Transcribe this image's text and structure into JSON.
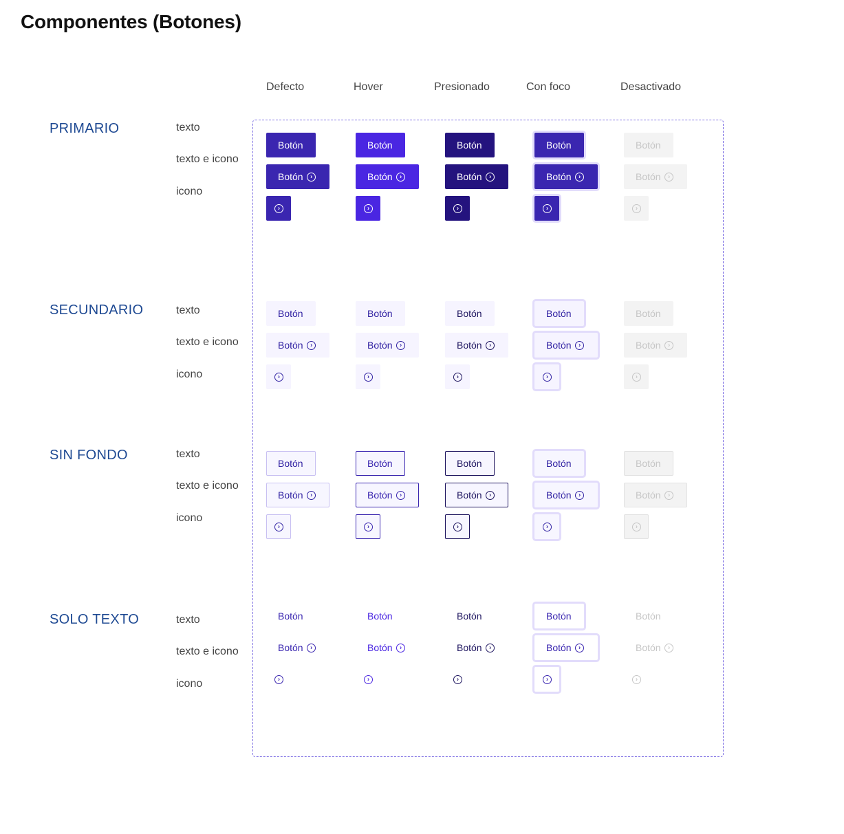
{
  "title": "Componentes (Botones)",
  "states": [
    "Defecto",
    "Hover",
    "Presionado",
    "Con foco",
    "Desactivado"
  ],
  "row_labels": {
    "text": "texto",
    "text_icon": "texto e icono",
    "icon": "icono"
  },
  "button_label": "Botón",
  "icon_name": "chevron-circle-right-icon",
  "groups": [
    {
      "key": "primario",
      "title": "PRIMARIO"
    },
    {
      "key": "secundario",
      "title": "SECUNDARIO"
    },
    {
      "key": "sin_fondo",
      "title": "SIN FONDO"
    },
    {
      "key": "solo_texto",
      "title": "SOLO TEXTO"
    }
  ],
  "colors": {
    "primary": "#3a26b0",
    "primary_hover": "#4a26e2",
    "primary_pressed": "#24137e",
    "focus_ring": "#e2dcfb",
    "secondary_bg": "#f6f4ff",
    "disabled_bg": "#f3f3f3",
    "disabled_text": "#c6c6c6",
    "group_title": "#1f4a93",
    "frame_border": "#8274e4"
  }
}
